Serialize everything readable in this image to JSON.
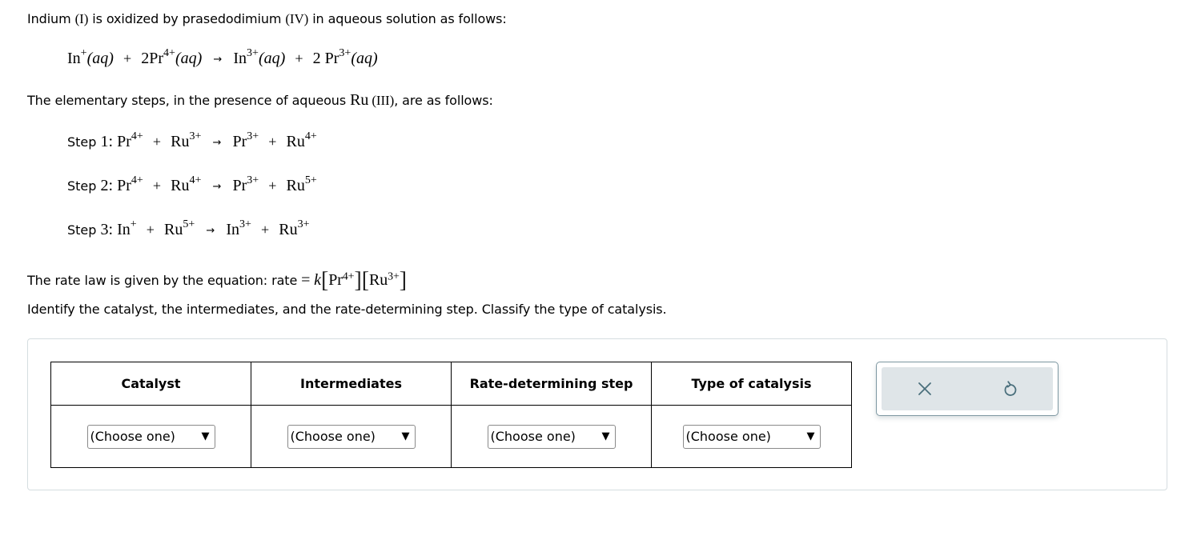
{
  "intro": {
    "text_before": "Indium ",
    "roman_1": "(I)",
    "text_mid": " is oxidized by prasedodimium ",
    "roman_2": "(IV)",
    "text_after": " in aqueous solution as follows:"
  },
  "overall_reaction": {
    "reactants": [
      {
        "coef": "",
        "species": "In",
        "charge": "+",
        "state": "(aq)"
      },
      {
        "coef": "2",
        "species": "Pr",
        "charge": "4+",
        "state": "(aq)"
      }
    ],
    "products": [
      {
        "coef": "",
        "species": "In",
        "charge": "3+",
        "state": "(aq)"
      },
      {
        "coef": "2 ",
        "species": "Pr",
        "charge": "3+",
        "state": "(aq)"
      }
    ],
    "plus": "+",
    "arrow": "→"
  },
  "elementary_intro": {
    "text_before": "The elementary steps, in the presence of aqueous ",
    "species": "Ru",
    "roman": " (III)",
    "text_after": ", are as follows:"
  },
  "steps": [
    {
      "label": "Step ",
      "number": "1",
      "colon": ": ",
      "reactants": [
        {
          "species": "Pr",
          "charge": "4+"
        },
        {
          "species": "Ru",
          "charge": "3+"
        }
      ],
      "products": [
        {
          "species": "Pr",
          "charge": "3+"
        },
        {
          "species": "Ru",
          "charge": "4+"
        }
      ]
    },
    {
      "label": "Step ",
      "number": "2",
      "colon": ": ",
      "reactants": [
        {
          "species": "Pr",
          "charge": "4+"
        },
        {
          "species": "Ru",
          "charge": "4+"
        }
      ],
      "products": [
        {
          "species": "Pr",
          "charge": "3+"
        },
        {
          "species": "Ru",
          "charge": "5+"
        }
      ]
    },
    {
      "label": "Step ",
      "number": "3",
      "colon": ": ",
      "reactants": [
        {
          "species": "In",
          "charge": "+"
        },
        {
          "species": "Ru",
          "charge": "5+"
        }
      ],
      "products": [
        {
          "species": "In",
          "charge": "3+"
        },
        {
          "species": "Ru",
          "charge": "3+"
        }
      ]
    }
  ],
  "rate_law": {
    "prefix": "The rate law is given by the equation: rate",
    "equals": " = ",
    "k": "k",
    "terms": [
      {
        "species": "Pr",
        "charge": "4+"
      },
      {
        "species": "Ru",
        "charge": "3+"
      }
    ]
  },
  "instruction": "Identify the catalyst, the intermediates, and the rate-determining step. Classify the type of catalysis.",
  "answer_table": {
    "headers": [
      "Catalyst",
      "Intermediates",
      "Rate-determining step",
      "Type of catalysis"
    ],
    "selects": [
      {
        "value": "(Choose one)",
        "caret": "▼"
      },
      {
        "value": "(Choose one)",
        "caret": "▼"
      },
      {
        "value": "(Choose one)",
        "caret": "▼"
      },
      {
        "value": "(Choose one)",
        "caret": "▼"
      }
    ]
  },
  "actions": {
    "clear_icon": "close-icon",
    "reset_icon": "undo-icon",
    "icon_color": "#4a6f7c"
  }
}
